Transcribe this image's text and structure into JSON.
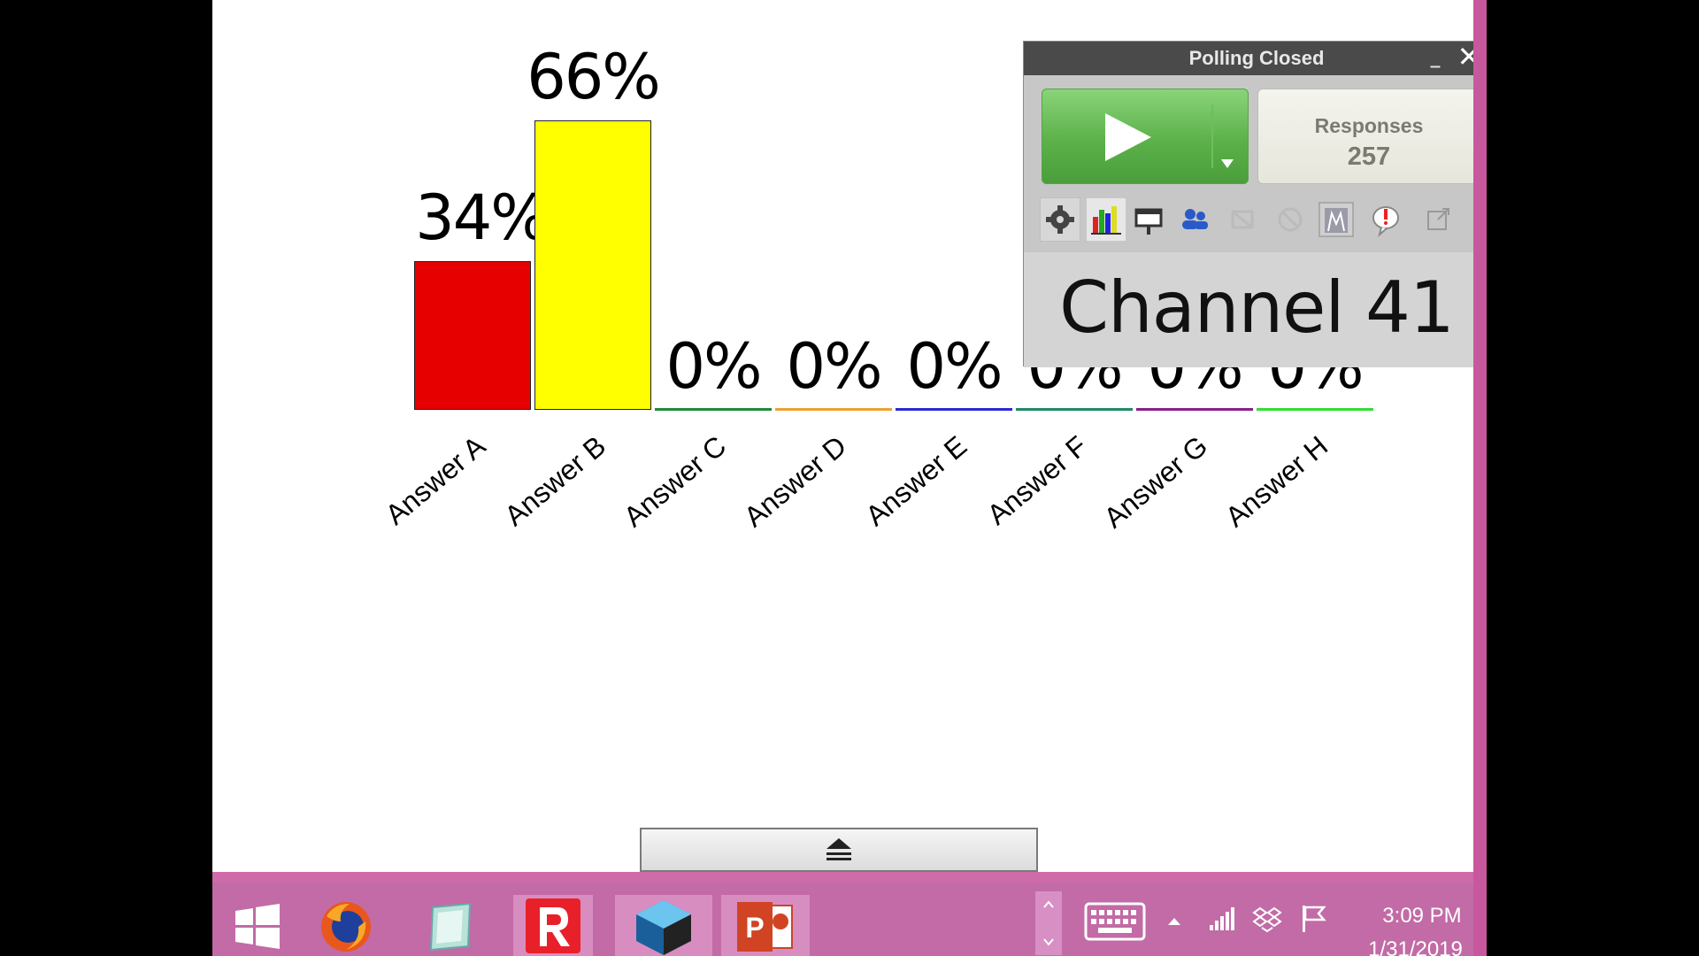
{
  "chart_data": {
    "type": "bar",
    "categories": [
      "Answer A",
      "Answer B",
      "Answer C",
      "Answer D",
      "Answer E",
      "Answer F",
      "Answer G",
      "Answer H"
    ],
    "values": [
      34,
      66,
      0,
      0,
      0,
      0,
      0,
      0
    ],
    "value_labels": [
      "34%",
      "66%",
      "0%",
      "0%",
      "0%",
      "0%",
      "0%",
      "0%"
    ],
    "colors": [
      "#e60000",
      "#ffff00",
      "#1f8a3c",
      "#f0a030",
      "#2a2ad6",
      "#1f8a6a",
      "#8a1f8a",
      "#33dd33"
    ],
    "ylim": [
      0,
      100
    ],
    "grid": false,
    "legend": "none"
  },
  "poll_panel": {
    "title": "Polling Closed",
    "minimize_label": "_",
    "close_label": "✕",
    "responses_label": "Responses",
    "responses_count": "257",
    "channel_text": "Channel 41",
    "toolbar_icons": [
      "gear-icon",
      "chart-icon",
      "presentation-icon",
      "participants-icon",
      "hide-icon",
      "reset-icon",
      "export-chart-icon",
      "alert-icon",
      "popout-icon"
    ]
  },
  "taskbar": {
    "apps": [
      "windows-start-icon",
      "firefox-icon",
      "notepad-icon",
      "r-app-icon",
      "cube-app-icon",
      "powerpoint-icon"
    ],
    "time": "3:09 PM",
    "date": "1/31/2019"
  },
  "colors": {
    "taskbar": "#cf6ba9",
    "play_green": "#5cb14a",
    "panel_bg": "#c7c7c7"
  }
}
